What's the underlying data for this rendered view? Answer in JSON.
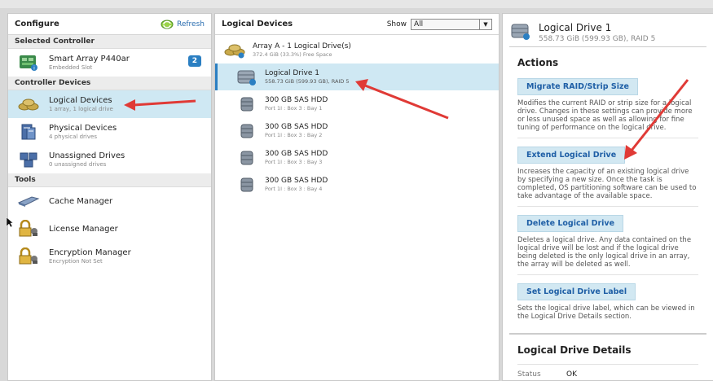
{
  "configure": {
    "title": "Configure",
    "refresh_label": "Refresh",
    "selected_controller_section": "Selected Controller",
    "controller": {
      "name": "Smart Array P440ar",
      "subtitle": "Embedded Slot",
      "badge": "2"
    },
    "controller_devices_section": "Controller Devices",
    "devices": [
      {
        "label": "Logical Devices",
        "subtitle": "1 array, 1 logical drive",
        "icon": "logical-devices-icon"
      },
      {
        "label": "Physical Devices",
        "subtitle": "4 physical drives",
        "icon": "physical-devices-icon"
      },
      {
        "label": "Unassigned Drives",
        "subtitle": "0 unassigned drives",
        "icon": "unassigned-drives-icon"
      }
    ],
    "tools_section": "Tools",
    "tools": [
      {
        "label": "Cache Manager",
        "subtitle": ""
      },
      {
        "label": "License Manager",
        "subtitle": ""
      },
      {
        "label": "Encryption Manager",
        "subtitle": "Encryption Not Set"
      }
    ]
  },
  "logical": {
    "title": "Logical Devices",
    "show_label": "Show",
    "show_value": "All",
    "array": {
      "label": "Array A - 1 Logical Drive(s)",
      "subtitle": "372.4 GiB (33.3%) Free Space"
    },
    "drive": {
      "label": "Logical Drive 1",
      "subtitle": "558.73 GiB (599.93 GB), RAID 5"
    },
    "disks": [
      {
        "label": "300 GB SAS HDD",
        "subtitle": "Port 1I : Box 3 : Bay 1"
      },
      {
        "label": "300 GB SAS HDD",
        "subtitle": "Port 1I : Box 3 : Bay 2"
      },
      {
        "label": "300 GB SAS HDD",
        "subtitle": "Port 1I : Box 3 : Bay 3"
      },
      {
        "label": "300 GB SAS HDD",
        "subtitle": "Port 1I : Box 3 : Bay 4"
      }
    ]
  },
  "detail": {
    "title": "Logical Drive 1",
    "subtitle": "558.73 GiB (599.93 GB), RAID 5",
    "actions_heading": "Actions",
    "actions": [
      {
        "label": "Migrate RAID/Strip Size",
        "desc": "Modifies the current RAID or strip size for a logical drive. Changes in these settings can provide more or less unused space as well as allowing for fine tuning of performance on the logical drive."
      },
      {
        "label": "Extend Logical Drive",
        "desc": "Increases the capacity of an existing logical drive by specifying a new size. Once the task is completed, OS partitioning software can be used to take advantage of the available space."
      },
      {
        "label": "Delete Logical Drive",
        "desc": "Deletes a logical drive. Any data contained on the logical drive will be lost and if the logical drive being deleted is the only logical drive in an array, the array will be deleted as well."
      },
      {
        "label": "Set Logical Drive Label",
        "desc": "Sets the logical drive label, which can be viewed in the Logical Drive Details section."
      }
    ],
    "details_heading": "Logical Drive Details",
    "status_key": "Status",
    "status_value": "OK"
  },
  "colors": {
    "selected_bg": "#cfe8f3",
    "accent": "#2b7fc2",
    "annotation_arrow": "#e03a36"
  }
}
